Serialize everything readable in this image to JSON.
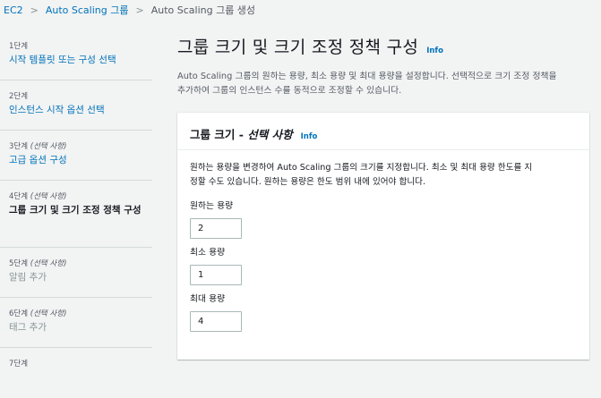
{
  "breadcrumb": {
    "items": [
      "EC2",
      "Auto Scaling 그룹",
      "Auto Scaling 그룹 생성"
    ],
    "separator": ">"
  },
  "steps": [
    {
      "number": "1단계",
      "optional": "",
      "title": "시작 템플릿 또는 구성 선택",
      "state": "link"
    },
    {
      "number": "2단계",
      "optional": "",
      "title": "인스턴스 시작 옵션 선택",
      "state": "link"
    },
    {
      "number": "3단계",
      "optional": "(선택 사항)",
      "title": "고급 옵션 구성",
      "state": "link"
    },
    {
      "number": "4단계",
      "optional": "(선택 사항)",
      "title": "그룹 크기 및 크기 조정 정책 구성",
      "state": "active"
    },
    {
      "number": "5단계",
      "optional": "(선택 사항)",
      "title": "알림 추가",
      "state": "disabled"
    },
    {
      "number": "6단계",
      "optional": "(선택 사항)",
      "title": "태그 추가",
      "state": "disabled"
    },
    {
      "number": "7단계",
      "optional": "",
      "title": "",
      "state": "disabled"
    }
  ],
  "main": {
    "title": "그룹 크기 및 크기 조정 정책 구성",
    "info": "Info",
    "description_line1": "Auto Scaling 그룹의 원하는 용량, 최소 용량 및 최대 용량을 설정합니다. 선택적으로 크기 조정 정책을",
    "description_line2": "추가하여 그룹의 인스턴스 수를 동적으로 조정할 수 있습니다."
  },
  "group_size_panel": {
    "title": "그룹 크기 - ",
    "title_optional": "선택 사항",
    "info": "Info",
    "description_line1": "원하는 용량을 변경하여 Auto Scaling 그룹의 크기를 지정합니다. 최소 및 최대 용량 한도를 지",
    "description_line2": "정할 수도 있습니다. 원하는 용량은 한도 범위 내에 있어야 합니다.",
    "fields": [
      {
        "label": "원하는 용량",
        "value": "2"
      },
      {
        "label": "최소 용량",
        "value": "1"
      },
      {
        "label": "최대 용량",
        "value": "4"
      }
    ]
  },
  "colors": {
    "link": "#0073bb",
    "background": "#f2f3f3",
    "panel": "#ffffff",
    "text": "#16191f",
    "muted": "#545b64"
  }
}
